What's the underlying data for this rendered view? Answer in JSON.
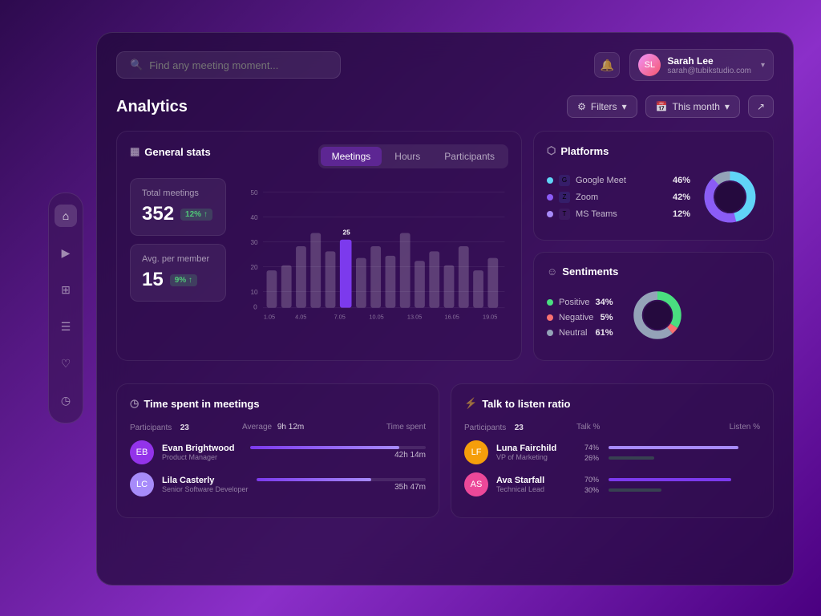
{
  "sidebar": {
    "items": [
      {
        "id": "home",
        "icon": "⌂",
        "active": true
      },
      {
        "id": "video",
        "icon": "▶",
        "active": false
      },
      {
        "id": "grid",
        "icon": "⊞",
        "active": false
      },
      {
        "id": "list",
        "icon": "☰",
        "active": false
      },
      {
        "id": "heart",
        "icon": "♡",
        "active": false
      },
      {
        "id": "clock",
        "icon": "◷",
        "active": false
      }
    ]
  },
  "header": {
    "search_placeholder": "Find any meeting moment...",
    "user": {
      "name": "Sarah Lee",
      "email": "sarah@tubikstudio.com",
      "initials": "SL"
    }
  },
  "page_title": "Analytics",
  "toolbar": {
    "filters_label": "Filters",
    "date_label": "This month"
  },
  "general_stats": {
    "title": "General stats",
    "tabs": [
      "Meetings",
      "Hours",
      "Participants"
    ],
    "active_tab": 0,
    "total_meetings": {
      "label": "Total meetings",
      "value": "352",
      "badge": "12% ↑"
    },
    "avg_per_member": {
      "label": "Avg. per member",
      "value": "15",
      "badge": "9% ↑"
    },
    "chart": {
      "y_labels": [
        "50",
        "40",
        "30",
        "20",
        "10",
        "0"
      ],
      "x_labels": [
        "1.05",
        "4.05",
        "7.05",
        "10.05",
        "13.05",
        "16.05",
        "19.05"
      ],
      "highlighted_bar": {
        "x": 7,
        "value": "25"
      },
      "bars": [
        {
          "x": 0,
          "height": 0.3
        },
        {
          "x": 1,
          "height": 0.35
        },
        {
          "x": 2,
          "height": 0.5
        },
        {
          "x": 3,
          "height": 0.6
        },
        {
          "x": 4,
          "height": 0.45
        },
        {
          "x": 5,
          "height": 0.55
        },
        {
          "x": 6,
          "height": 0.4
        },
        {
          "x": 7,
          "height": 0.5
        },
        {
          "x": 8,
          "height": 0.42
        },
        {
          "x": 9,
          "height": 0.6
        },
        {
          "x": 10,
          "height": 0.38
        },
        {
          "x": 11,
          "height": 0.45
        },
        {
          "x": 12,
          "height": 0.35
        },
        {
          "x": 13,
          "height": 0.5
        },
        {
          "x": 14,
          "height": 0.3
        },
        {
          "x": 15,
          "height": 0.4
        }
      ]
    }
  },
  "platforms": {
    "title": "Platforms",
    "items": [
      {
        "name": "Google Meet",
        "pct": "46%",
        "color": "#60d4f7",
        "logo_color": "#4285f4"
      },
      {
        "name": "Zoom",
        "pct": "42%",
        "color": "#8b5cf6",
        "logo_color": "#2d8cff"
      },
      {
        "name": "MS Teams",
        "pct": "12%",
        "color": "#a78bfa",
        "logo_color": "#6264a7"
      }
    ],
    "donut": {
      "segments": [
        {
          "pct": 46,
          "color": "#60d4f7"
        },
        {
          "pct": 42,
          "color": "#8b5cf6"
        },
        {
          "pct": 12,
          "color": "#a78bfa"
        }
      ]
    }
  },
  "sentiments": {
    "title": "Sentiments",
    "items": [
      {
        "name": "Positive",
        "pct": "34%",
        "color": "#4ade80"
      },
      {
        "name": "Negative",
        "pct": "5%",
        "color": "#f87171"
      },
      {
        "name": "Neutral",
        "pct": "61%",
        "color": "#94a3b8"
      }
    ],
    "donut": {
      "segments": [
        {
          "pct": 34,
          "color": "#4ade80"
        },
        {
          "pct": 5,
          "color": "#f87171"
        },
        {
          "pct": 61,
          "color": "#94a3b8"
        }
      ]
    }
  },
  "time_spent": {
    "title": "Time spent in meetings",
    "participants_count": "23",
    "average_label": "Average",
    "average_value": "9h 12m",
    "time_spent_label": "Time spent",
    "people": [
      {
        "name": "Evan Brightwood",
        "role": "Product Manager",
        "bar_pct": 85,
        "bar_color": "#7c3aed",
        "value": "42h 14m",
        "initials": "EB",
        "avatar_color": "#9333ea"
      },
      {
        "name": "Lila Casterly",
        "role": "Senior Software Developer",
        "bar_pct": 68,
        "bar_color": "#7c3aed",
        "value": "35h 47m",
        "initials": "LC",
        "avatar_color": "#a78bfa"
      }
    ]
  },
  "talk_listen": {
    "title": "Talk to listen ratio",
    "participants_count": "23",
    "talk_label": "Talk %",
    "listen_label": "Listen %",
    "people": [
      {
        "name": "Luna Fairchild",
        "role": "VP of Marketing",
        "talk_pct": 74,
        "listen_pct": 26,
        "talk_label": "74%",
        "listen_label": "26%",
        "talk_color": "#a78bfa",
        "listen_color": "#374151",
        "initials": "LF",
        "avatar_color": "#f59e0b"
      },
      {
        "name": "Ava Starfall",
        "role": "Technical Lead",
        "talk_pct": 70,
        "listen_pct": 30,
        "talk_label": "70%",
        "listen_label": "30%",
        "talk_color": "#7c3aed",
        "listen_color": "#374151",
        "initials": "AS",
        "avatar_color": "#ec4899"
      }
    ]
  }
}
